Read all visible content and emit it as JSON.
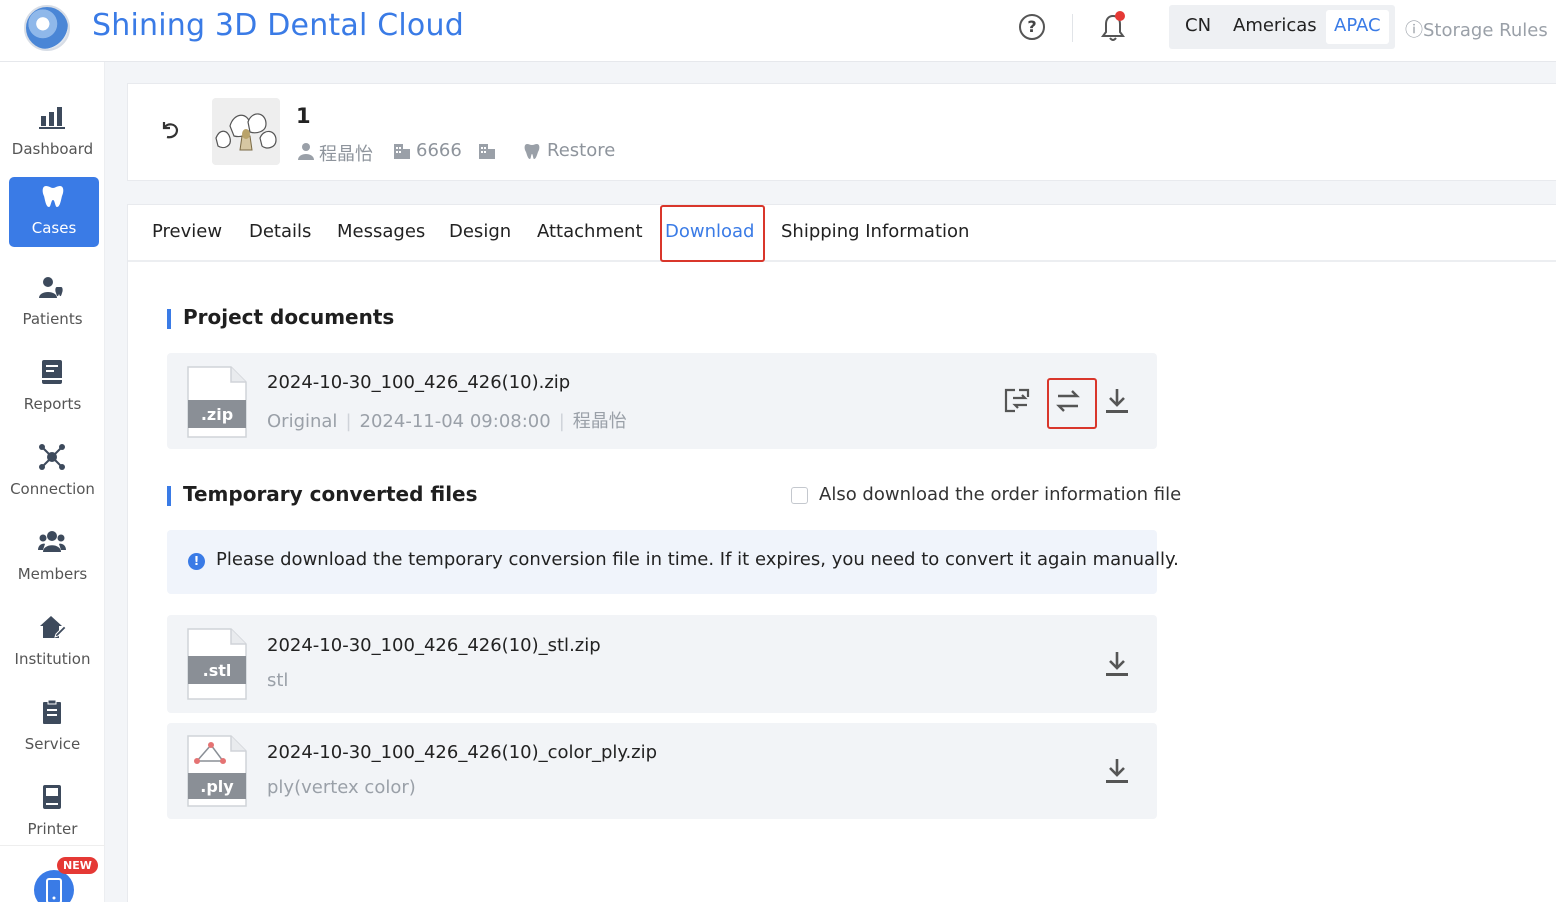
{
  "header": {
    "app_title": "Shining 3D Dental Cloud",
    "help_symbol": "?",
    "regions": [
      "CN",
      "Americas",
      "APAC"
    ],
    "active_region": "APAC",
    "storage_rules": "Storage Rules",
    "storage_rules_symbol": "ⓘ"
  },
  "sidebar": {
    "items": [
      {
        "label": "Dashboard",
        "icon": "bar-chart-icon"
      },
      {
        "label": "Cases",
        "icon": "tooth-icon",
        "active": true
      },
      {
        "label": "Patients",
        "icon": "patient-icon"
      },
      {
        "label": "Reports",
        "icon": "report-icon"
      },
      {
        "label": "Connection",
        "icon": "connection-icon"
      },
      {
        "label": "Members",
        "icon": "members-icon"
      },
      {
        "label": "Institution",
        "icon": "institution-icon"
      },
      {
        "label": "Service",
        "icon": "service-icon"
      },
      {
        "label": "Printer",
        "icon": "printer-icon"
      }
    ],
    "new_badge": "NEW"
  },
  "case": {
    "name": "1",
    "patient": "程晶怡",
    "code": "6666",
    "type": "Restore"
  },
  "tabs": [
    "Preview",
    "Details",
    "Messages",
    "Design",
    "Attachment",
    "Download",
    "Shipping Information"
  ],
  "active_tab": "Download",
  "project_documents": {
    "title": "Project documents",
    "file": {
      "ext": ".zip",
      "name": "2024-10-30_100_426_426(10).zip",
      "kind": "Original",
      "date": "2024-11-04 09:08:00",
      "author": "程晶怡"
    }
  },
  "temporary_files": {
    "title": "Temporary converted files",
    "checkbox_label": "Also download the order information file",
    "notice_symbol": "!",
    "notice": "Please download the temporary conversion file in time. If it expires, you need to convert it again manually.",
    "files": [
      {
        "ext": ".stl",
        "name": "2024-10-30_100_426_426(10)_stl.zip",
        "format": "stl"
      },
      {
        "ext": ".ply",
        "name": "2024-10-30_100_426_426(10)_color_ply.zip",
        "format": "ply(vertex color)"
      }
    ]
  },
  "colors": {
    "accent": "#3a7be6",
    "highlight_red": "#d9362b",
    "badge_red": "#e53935"
  }
}
